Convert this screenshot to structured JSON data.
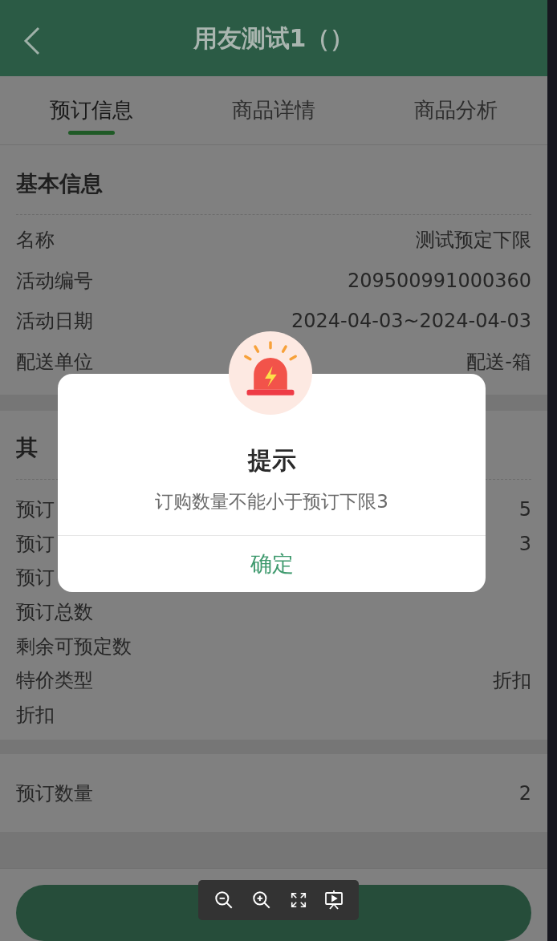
{
  "header": {
    "title": "用友测试1（）"
  },
  "tabs": [
    {
      "label": "预订信息",
      "selected": true
    },
    {
      "label": "商品详情",
      "selected": false
    },
    {
      "label": "商品分析",
      "selected": false
    }
  ],
  "basic_info": {
    "title": "基本信息",
    "rows": [
      {
        "label": "名称",
        "value": "测试预定下限"
      },
      {
        "label": "活动编号",
        "value": "209500991000360"
      },
      {
        "label": "活动日期",
        "value": "2024-04-03~2024-04-03"
      },
      {
        "label": "配送单位",
        "value": "配送-箱"
      }
    ]
  },
  "other_info": {
    "title": "其",
    "rows": [
      {
        "label": "预订",
        "value": "5"
      },
      {
        "label": "预订",
        "value": "3"
      },
      {
        "label": "预订"
      },
      {
        "label": "预订总数"
      },
      {
        "label": "剩余可预定数"
      },
      {
        "label": "特价类型",
        "value": "折扣"
      },
      {
        "label": "折扣"
      }
    ]
  },
  "order_quantity": {
    "label": "预订数量",
    "value": "2"
  },
  "dialog": {
    "title": "提示",
    "message": "订购数量不能小于预订下限3",
    "confirm": "确定"
  }
}
